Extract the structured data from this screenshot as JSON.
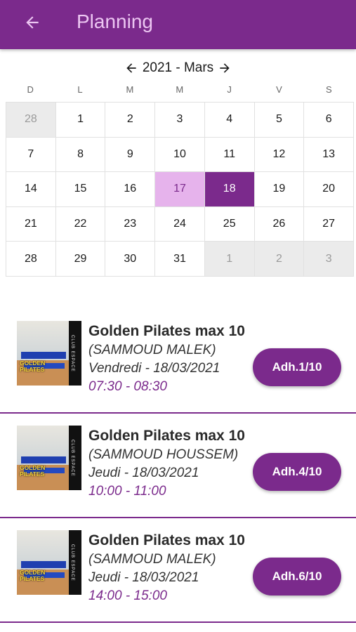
{
  "header": {
    "title": "Planning",
    "back_icon": "arrow-left-icon"
  },
  "calendar": {
    "month_label": "2021 - Mars",
    "weekdays": [
      "D",
      "L",
      "M",
      "M",
      "J",
      "V",
      "S"
    ],
    "days": [
      {
        "label": "28",
        "state": "other"
      },
      {
        "label": "1",
        "state": ""
      },
      {
        "label": "2",
        "state": ""
      },
      {
        "label": "3",
        "state": ""
      },
      {
        "label": "4",
        "state": ""
      },
      {
        "label": "5",
        "state": ""
      },
      {
        "label": "6",
        "state": ""
      },
      {
        "label": "7",
        "state": ""
      },
      {
        "label": "8",
        "state": ""
      },
      {
        "label": "9",
        "state": ""
      },
      {
        "label": "10",
        "state": ""
      },
      {
        "label": "11",
        "state": ""
      },
      {
        "label": "12",
        "state": ""
      },
      {
        "label": "13",
        "state": ""
      },
      {
        "label": "14",
        "state": ""
      },
      {
        "label": "15",
        "state": ""
      },
      {
        "label": "16",
        "state": ""
      },
      {
        "label": "17",
        "state": "today"
      },
      {
        "label": "18",
        "state": "selected"
      },
      {
        "label": "19",
        "state": ""
      },
      {
        "label": "20",
        "state": ""
      },
      {
        "label": "21",
        "state": ""
      },
      {
        "label": "22",
        "state": ""
      },
      {
        "label": "23",
        "state": ""
      },
      {
        "label": "24",
        "state": ""
      },
      {
        "label": "25",
        "state": ""
      },
      {
        "label": "26",
        "state": ""
      },
      {
        "label": "27",
        "state": ""
      },
      {
        "label": "28",
        "state": ""
      },
      {
        "label": "29",
        "state": ""
      },
      {
        "label": "30",
        "state": ""
      },
      {
        "label": "31",
        "state": ""
      },
      {
        "label": "1",
        "state": "other"
      },
      {
        "label": "2",
        "state": "other"
      },
      {
        "label": "3",
        "state": "other"
      }
    ]
  },
  "sessions": [
    {
      "title": "Golden Pilates max 10",
      "coach": "(SAMMOUD MALEK)",
      "date": "Vendredi - 18/03/2021",
      "time": "07:30 - 08:30",
      "button": "Adh.1/10",
      "thumb_brand": "GOLDEN PILATES",
      "thumb_side": "CLUB ESPACE"
    },
    {
      "title": "Golden Pilates max 10",
      "coach": "(SAMMOUD HOUSSEM)",
      "date": "Jeudi - 18/03/2021",
      "time": "10:00 - 11:00",
      "button": "Adh.4/10",
      "thumb_brand": "GOLDEN PILATES",
      "thumb_side": "CLUB ESPACE"
    },
    {
      "title": "Golden Pilates max 10",
      "coach": "(SAMMOUD MALEK)",
      "date": "Jeudi - 18/03/2021",
      "time": "14:00 - 15:00",
      "button": "Adh.6/10",
      "thumb_brand": "GOLDEN PILATES",
      "thumb_side": "CLUB ESPACE"
    }
  ],
  "colors": {
    "primary": "#7b2a8c",
    "today_bg": "#e6b3ec",
    "other_bg": "#ebebeb",
    "title_text": "#ecc6f2"
  }
}
